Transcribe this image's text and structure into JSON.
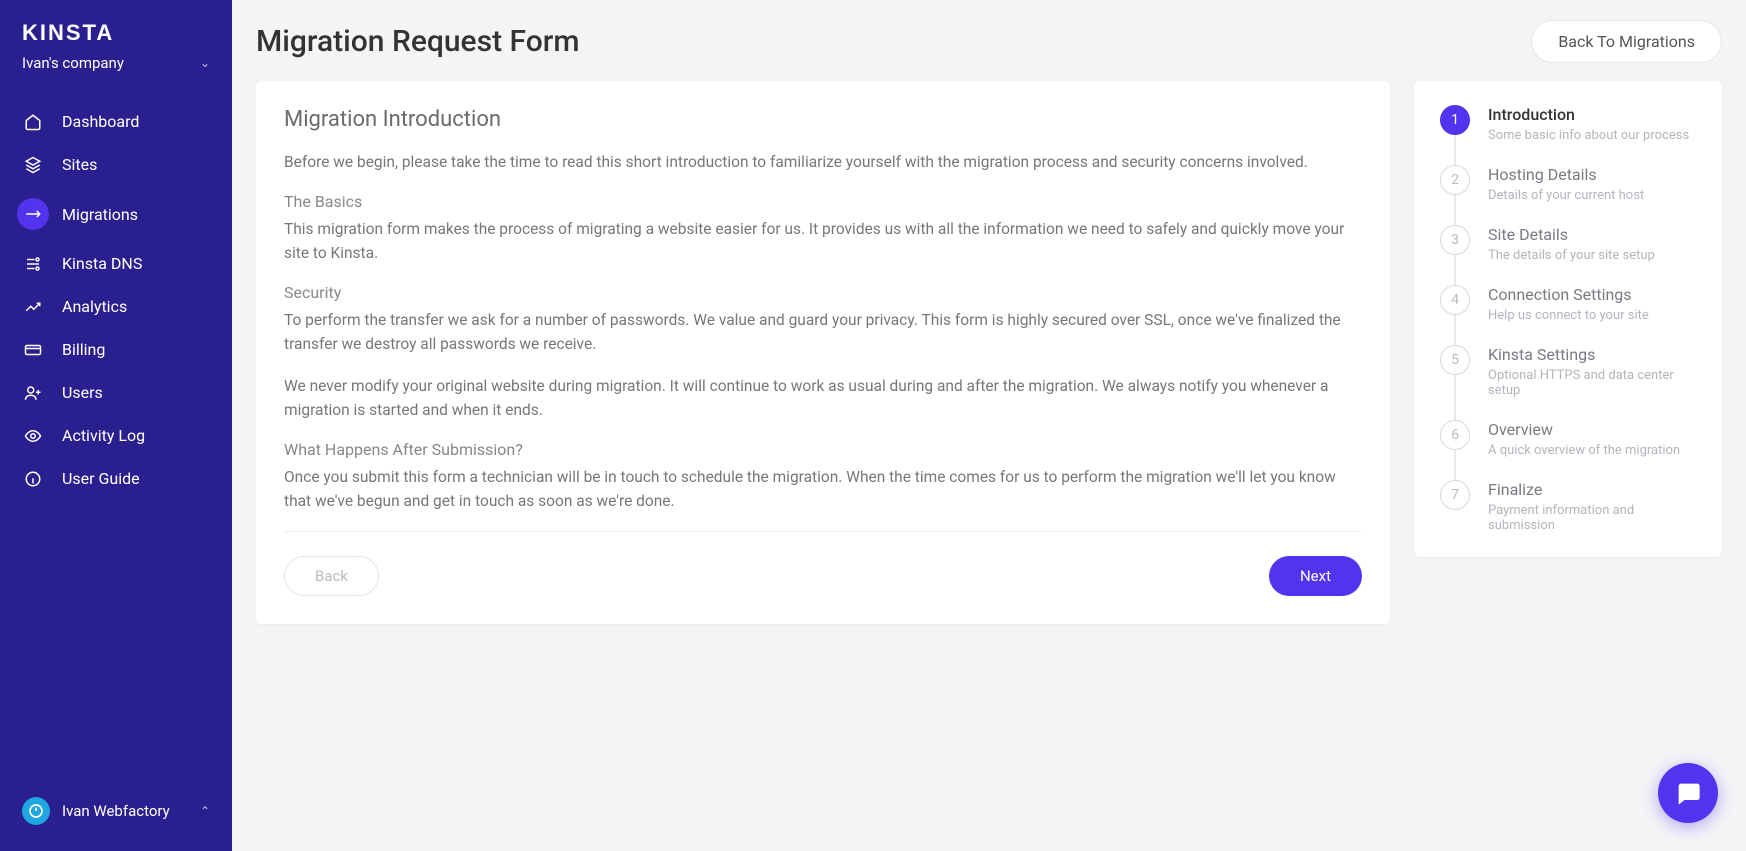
{
  "brand": "KINSTA",
  "company": {
    "name": "Ivan's company"
  },
  "nav": [
    {
      "label": "Dashboard",
      "icon": "home-icon"
    },
    {
      "label": "Sites",
      "icon": "stack-icon"
    },
    {
      "label": "Migrations",
      "icon": "migration-icon",
      "active": true
    },
    {
      "label": "Kinsta DNS",
      "icon": "dns-icon"
    },
    {
      "label": "Analytics",
      "icon": "analytics-icon"
    },
    {
      "label": "Billing",
      "icon": "billing-icon"
    },
    {
      "label": "Users",
      "icon": "users-icon"
    },
    {
      "label": "Activity Log",
      "icon": "eye-icon"
    },
    {
      "label": "User Guide",
      "icon": "info-icon"
    }
  ],
  "user": {
    "name": "Ivan Webfactory"
  },
  "header": {
    "title": "Migration Request Form",
    "back_label": "Back To Migrations"
  },
  "intro": {
    "title": "Migration Introduction",
    "lead": "Before we begin, please take the time to read this short introduction to familiarize yourself with the migration process and security concerns involved.",
    "s1_title": "The Basics",
    "s1_body": "This migration form makes the process of migrating a website easier for us. It provides us with all the information we need to safely and quickly move your site to Kinsta.",
    "s2_title": "Security",
    "s2_body1": "To perform the transfer we ask for a number of passwords. We value and guard your privacy. This form is highly secured over SSL, once we've finalized the transfer we destroy all passwords we receive.",
    "s2_body2": "We never modify your original website during migration. It will continue to work as usual during and after the migration. We always notify you whenever a migration is started and when it ends.",
    "s3_title": "What Happens After Submission?",
    "s3_body": "Once you submit this form a technician will be in touch to schedule the migration. When the time comes for us to perform the migration we'll let you know that we've begun and get in touch as soon as we're done."
  },
  "actions": {
    "back": "Back",
    "next": "Next"
  },
  "steps": [
    {
      "num": "1",
      "label": "Introduction",
      "desc": "Some basic info about our process",
      "active": true
    },
    {
      "num": "2",
      "label": "Hosting Details",
      "desc": "Details of your current host"
    },
    {
      "num": "3",
      "label": "Site Details",
      "desc": "The details of your site setup"
    },
    {
      "num": "4",
      "label": "Connection Settings",
      "desc": "Help us connect to your site"
    },
    {
      "num": "5",
      "label": "Kinsta Settings",
      "desc": "Optional HTTPS and data center setup"
    },
    {
      "num": "6",
      "label": "Overview",
      "desc": "A quick overview of the migration"
    },
    {
      "num": "7",
      "label": "Finalize",
      "desc": "Payment information and submission"
    }
  ]
}
